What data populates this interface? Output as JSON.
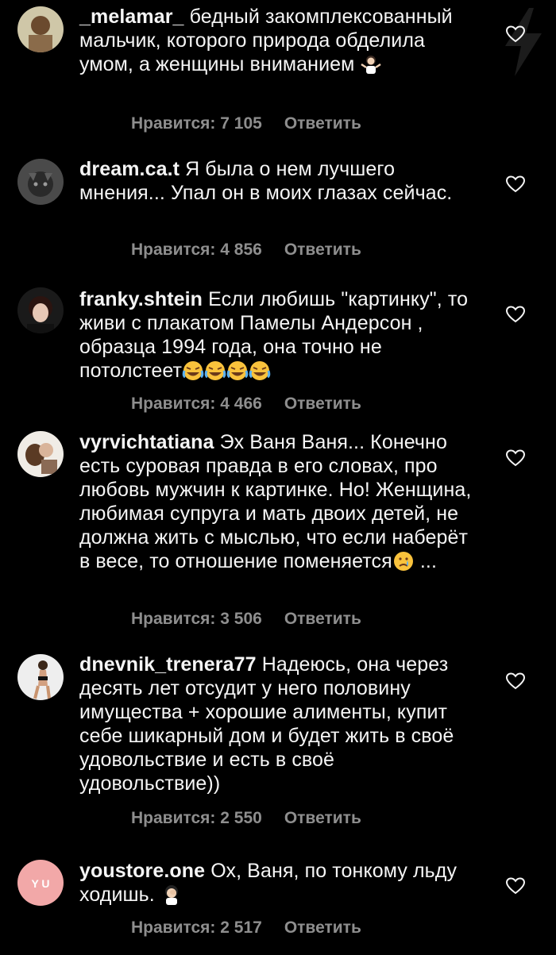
{
  "comments": [
    {
      "username": "_melamar_",
      "text": "бедный закомплексованный мальчик, которого природа обделила умом, а женщины вниманием",
      "emoji": "person-shrugging",
      "likes": "Нравится: 7 105",
      "reply": "Ответить"
    },
    {
      "username": "dream.ca.t",
      "text": "Я была о нем лучшего мнения... Упал он в моих глазах сейчас.",
      "emoji": "",
      "likes": "Нравится: 4 856",
      "reply": "Ответить"
    },
    {
      "username": "franky.shtein",
      "text": "Если любишь \"картинку\", то живи с плакатом Памелы Андерсон , образца 1994 года, она точно не потолстеет",
      "emoji": "laughing-crying x4",
      "likes": "Нравится: 4 466",
      "reply": "Ответить"
    },
    {
      "username": "vyrvichtatiana",
      "text": "Эх Ваня Ваня... Конечно есть суровая правда в его словах, про любовь мужчин к картинке. Но! Женщина, любимая супруга и мать двоих детей, не должна жить с мыслью, что если наберёт в весе, то отношение поменяется",
      "text_after": "...",
      "emoji": "crying-face",
      "likes": "Нравится: 3 506",
      "reply": "Ответить"
    },
    {
      "username": "dnevnik_trenera77",
      "text": "Надеюсь, она через десять лет отсудит у него половину имущества + хорошие алименты, купит себе шикарный дом и будет жить в своё удовольствие и есть в своё удовольствие))",
      "emoji": "",
      "likes": "Нравится: 2 550",
      "reply": "Ответить"
    },
    {
      "username": "youstore.one",
      "text": "Ох, Ваня, по тонкому льду ходишь.",
      "emoji": "face-palm",
      "likes": "Нравится: 2 517",
      "reply": "Ответить"
    }
  ],
  "avatar_text": {
    "youstore": "Y U"
  },
  "colors": {
    "background": "#000000",
    "text": "#f5f5f5",
    "meta": "#8e8e8e",
    "avatar_youstore": "#f2a8a8"
  }
}
